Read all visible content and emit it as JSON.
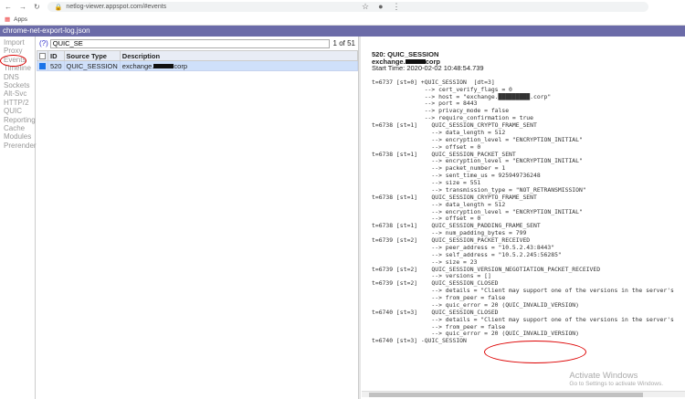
{
  "browser": {
    "url": "netlog-viewer.appspot.com/#events",
    "bookmark": "Apps"
  },
  "header": {
    "title": "chrome-net-export-log.json"
  },
  "sidebar": {
    "items": [
      "Import",
      "Proxy",
      "Events",
      "Timeline",
      "DNS",
      "Sockets",
      "Alt-Svc",
      "HTTP/2",
      "QUIC",
      "Reporting",
      "Cache",
      "Modules",
      "Prerender"
    ]
  },
  "filter": {
    "help": "(?)",
    "value": "QUIC_SE",
    "count": "1 of 51"
  },
  "table": {
    "headers": [
      "ID",
      "Source Type",
      "Description"
    ],
    "rows": [
      {
        "id": "520",
        "type": "QUIC_SESSION",
        "desc_prefix": "exchange.",
        "desc_suffix": "corp",
        "checked": true
      }
    ]
  },
  "details": {
    "title": "520: QUIC_SESSION",
    "host_prefix": "exchange.",
    "host_suffix": "corp",
    "start_time": "Start Time: 2020-02-02 10:48:54.739",
    "log": "t=6737 [st=0] +QUIC_SESSION  [dt=3]\n               --> cert_verify_flags = 0\n               --> host = \"exchange.█████████.corp\"\n               --> port = 8443\n               --> privacy_mode = false\n               --> require_confirmation = true\nt=6738 [st=1]    QUIC_SESSION_CRYPTO_FRAME_SENT\n                 --> data_length = 512\n                 --> encryption_level = \"ENCRYPTION_INITIAL\"\n                 --> offset = 0\nt=6738 [st=1]    QUIC_SESSION_PACKET_SENT\n                 --> encryption_level = \"ENCRYPTION_INITIAL\"\n                 --> packet_number = 1\n                 --> sent_time_us = 925949736248\n                 --> size = 551\n                 --> transmission_type = \"NOT_RETRANSMISSION\"\nt=6738 [st=1]    QUIC_SESSION_CRYPTO_FRAME_SENT\n                 --> data_length = 512\n                 --> encryption_level = \"ENCRYPTION_INITIAL\"\n                 --> offset = 0\nt=6738 [st=1]    QUIC_SESSION_PADDING_FRAME_SENT\n                 --> num_padding_bytes = 799\nt=6739 [st=2]    QUIC_SESSION_PACKET_RECEIVED\n                 --> peer_address = \"10.5.2.43:8443\"\n                 --> self_address = \"10.5.2.245:56285\"\n                 --> size = 23\nt=6739 [st=2]    QUIC_SESSION_VERSION_NEGOTIATION_PACKET_RECEIVED\n                 --> versions = []\nt=6739 [st=2]    QUIC_SESSION_CLOSED\n                 --> details = \"Client may support one of the versions in the server's\n                 --> from_peer = false\n                 --> quic_error = 20 (QUIC_INVALID_VERSION)\nt=6740 [st=3]    QUIC_SESSION_CLOSED\n                 --> details = \"Client may support one of the versions in the server's\n                 --> from_peer = false\n                 --> quic_error = 20 (QUIC_INVALID_VERSION)\nt=6740 [st=3] -QUIC_SESSION"
  },
  "watermark": {
    "line1": "Activate Windows",
    "line2": "Go to Settings to activate Windows."
  },
  "colors": {
    "header": "#6b6ba8",
    "selected_row": "#cfe0fa",
    "annotation": "#dd0000"
  }
}
